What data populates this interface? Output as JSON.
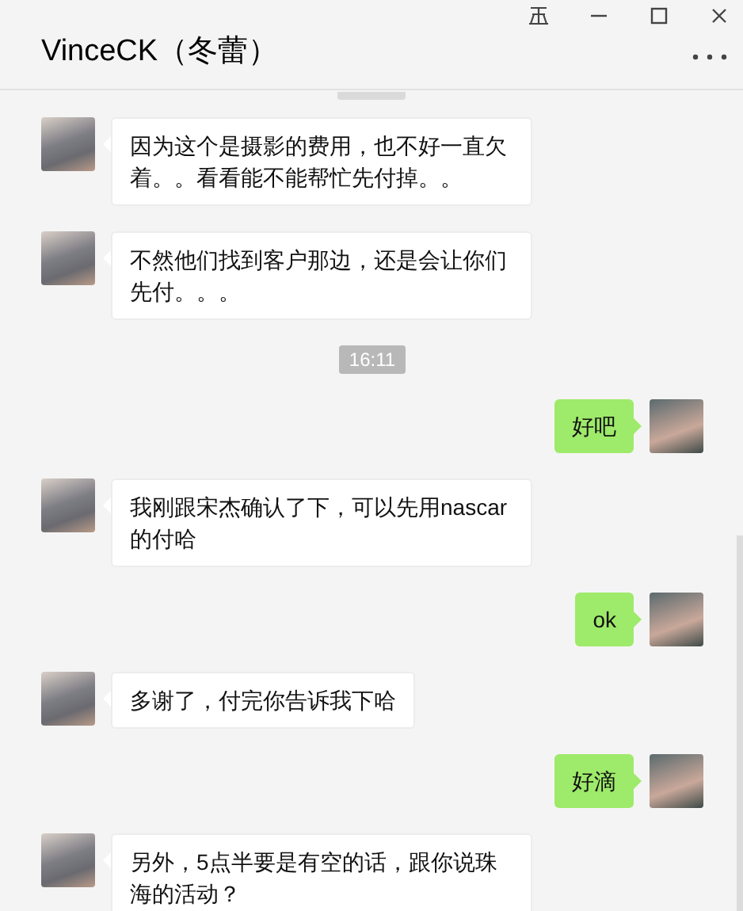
{
  "window": {
    "title": "VinceCK（冬蕾）"
  },
  "messages": [
    {
      "kind": "incoming",
      "text": "因为这个是摄影的费用，也不好一直欠着。。看看能不能帮忙先付掉。。"
    },
    {
      "kind": "incoming",
      "text": "不然他们找到客户那边，还是会让你们先付。。。"
    },
    {
      "kind": "time",
      "text": "16:11"
    },
    {
      "kind": "outgoing",
      "text": "好吧"
    },
    {
      "kind": "incoming",
      "text": "我刚跟宋杰确认了下，可以先用nascar的付哈"
    },
    {
      "kind": "outgoing",
      "text": "ok"
    },
    {
      "kind": "incoming",
      "text": "多谢了，付完你告诉我下哈"
    },
    {
      "kind": "outgoing",
      "text": "好滴"
    },
    {
      "kind": "incoming",
      "text": "另外，5点半要是有空的话，跟你说珠海的活动？"
    }
  ]
}
